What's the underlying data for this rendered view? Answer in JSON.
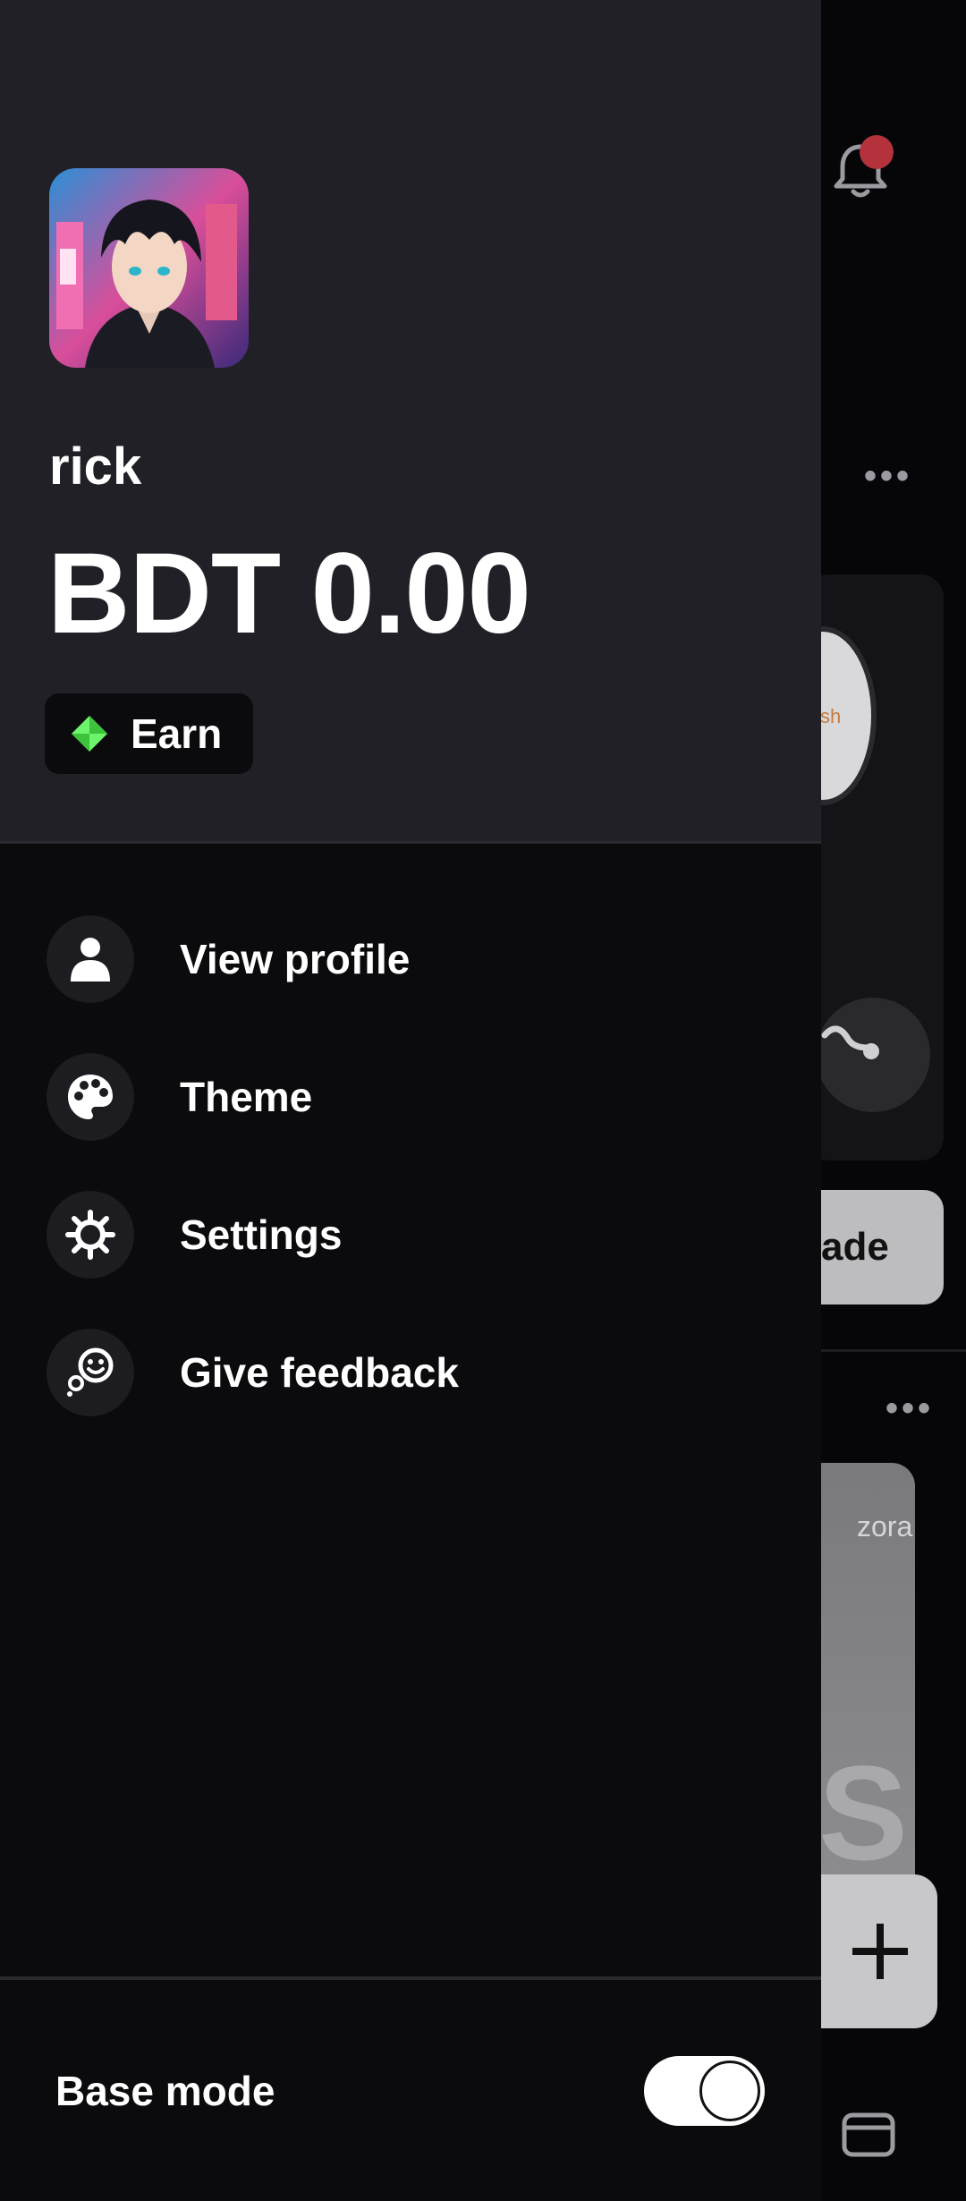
{
  "drawer": {
    "username": "rick",
    "balance": "BDT 0.00",
    "earn_label": "Earn",
    "menu": [
      {
        "label": "View profile",
        "icon": "person-icon"
      },
      {
        "label": "Theme",
        "icon": "palette-icon"
      },
      {
        "label": "Settings",
        "icon": "gear-icon"
      },
      {
        "label": "Give feedback",
        "icon": "feedback-icon"
      }
    ],
    "base_mode_label": "Base mode",
    "base_mode_on": true
  },
  "background": {
    "trade_partial": "ade",
    "media_label_partial": "zora",
    "media_big_partial": "S",
    "coin_partial": "sh",
    "dots": "•••"
  },
  "colors": {
    "drawer_header_bg": "#202026",
    "drawer_bg": "#0b0b0e",
    "notification_dot": "#b3323b",
    "earn_icon": "#6cf56a"
  }
}
